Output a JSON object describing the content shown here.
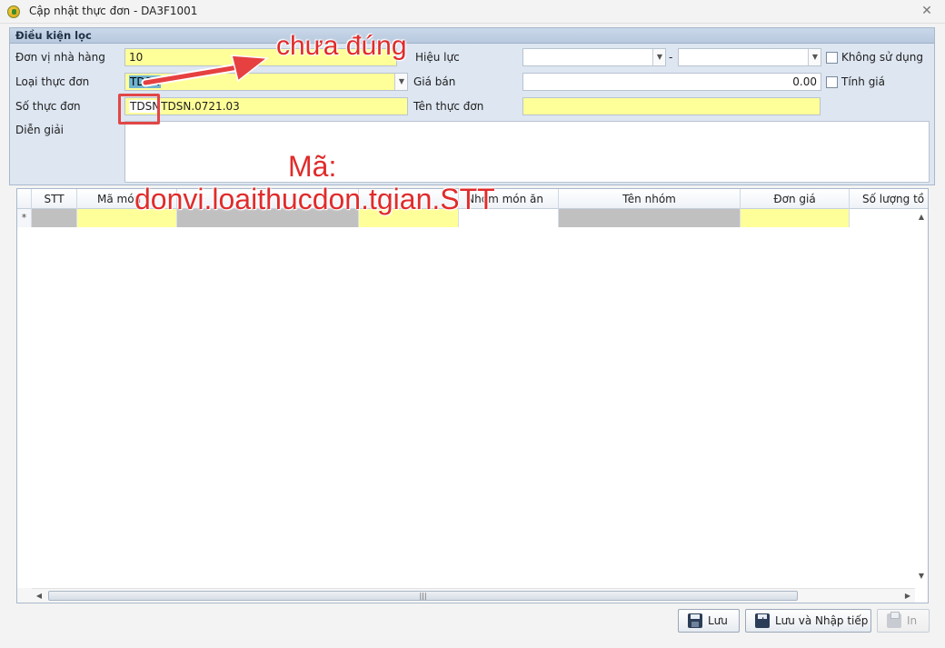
{
  "window": {
    "title": "Cập nhật thực đơn - DA3F1001",
    "close_glyph": "✕",
    "icon": "app-icon"
  },
  "filter_panel": {
    "header": "Điều kiện lọc",
    "labels": {
      "unit": "Đơn vị nhà hàng",
      "menu_type": "Loại thực đơn",
      "menu_no": "Số thực đơn",
      "description": "Diễn giải",
      "validity": "Hiệu lực",
      "price": "Giá bán",
      "menu_name": "Tên thực đơn",
      "not_used": "Không sử dụng",
      "calc_price": "Tính giá",
      "dash": "-"
    },
    "values": {
      "unit": "10",
      "menu_type": "TDSN",
      "menu_no_prefix": "TDSN",
      "menu_no": "TDSN.0721.03",
      "validity_from": "",
      "validity_to": "",
      "price": "0.00",
      "menu_name": "",
      "description": ""
    }
  },
  "grid": {
    "columns": [
      "STT",
      "Mã món",
      "",
      "Nhóm món ăn",
      "Tên nhóm",
      "Đơn giá",
      "Số lượng tồ"
    ],
    "new_row_marker": "*",
    "hscroll_grip": "|||"
  },
  "buttons": {
    "save": "Lưu",
    "save_next": "Lưu và Nhập tiếp",
    "print": "In"
  },
  "annotations": {
    "wrong": "chưa đúng",
    "code_label": "Mã:",
    "code_format": "donvi.loaithucdon.tgian.STT"
  }
}
